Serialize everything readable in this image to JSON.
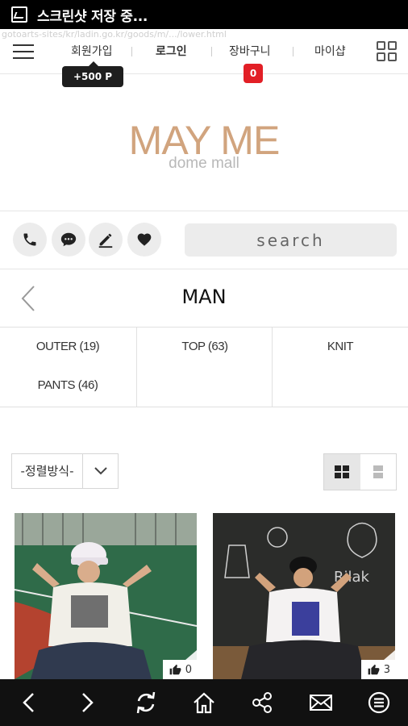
{
  "status_bar": {
    "notification_text": "스크린샷 저장 중..."
  },
  "url_ghost": "gotoarts-sites/kr/ladin.go.kr/goods/m/.../lower.html",
  "top_nav": {
    "links": [
      {
        "label": "회원가입"
      },
      {
        "label": "로그인"
      },
      {
        "label": "장바구니"
      },
      {
        "label": "마이샵"
      }
    ],
    "point_badge": "+500 P",
    "cart_count": "0"
  },
  "logo": {
    "main": "MAY ME",
    "sub": "dome mall"
  },
  "search": {
    "placeholder": "search"
  },
  "page_title": "MAN",
  "categories": [
    {
      "label": "OUTER (19)"
    },
    {
      "label": "TOP (63)"
    },
    {
      "label": "KNIT"
    },
    {
      "label": "PANTS (46)"
    }
  ],
  "sort": {
    "selected": "-정렬방식-"
  },
  "products": [
    {
      "likes": "0"
    },
    {
      "likes": "3"
    }
  ],
  "colors": {
    "brand": "#d1a47e",
    "cart_badge": "#e21f26",
    "bottom_bar": "#111111"
  },
  "icons": [
    "menu-icon",
    "grid-menu-icon",
    "phone-icon",
    "chat-icon",
    "pencil-icon",
    "heart-icon",
    "back-arrow-icon",
    "chevron-down-icon",
    "grid-view-icon",
    "list-view-icon",
    "thumbs-up-icon",
    "back-icon",
    "forward-icon",
    "refresh-icon",
    "home-icon",
    "share-icon",
    "mail-icon",
    "menu-circle-icon"
  ]
}
